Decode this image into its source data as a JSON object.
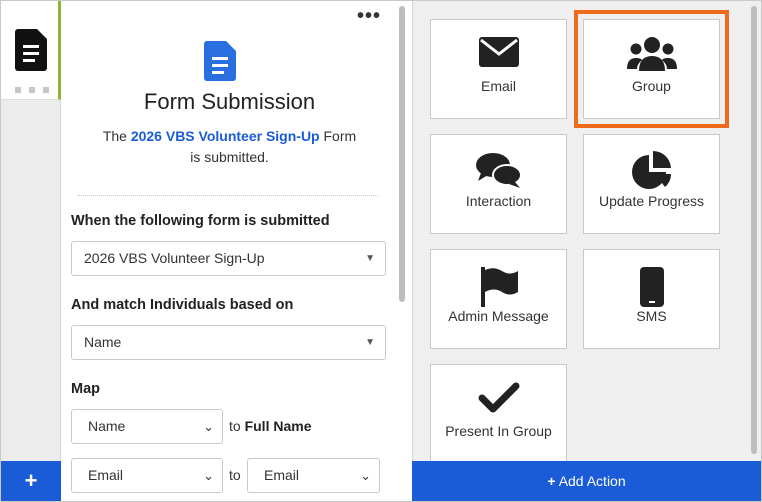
{
  "rail": {
    "add_label": "+"
  },
  "config": {
    "more_label": "•••",
    "title": "Form Submission",
    "subtitle_prefix": "The",
    "subtitle_form": "2026 VBS Volunteer Sign-Up",
    "subtitle_mid": "Form",
    "subtitle_suffix": "is submitted.",
    "form_label": "When the following form is submitted",
    "form_value": "2026 VBS Volunteer Sign-Up",
    "match_label": "And match Individuals based on",
    "match_value": "Name",
    "map_label": "Map",
    "map_rows": [
      {
        "left": "Name",
        "to": "to",
        "right_bold": "Full Name"
      },
      {
        "left": "Email",
        "to": "to",
        "right": "Email"
      }
    ]
  },
  "palette": {
    "tiles": [
      {
        "label": "Email",
        "icon": "envelope-icon"
      },
      {
        "label": "Group",
        "icon": "users-icon",
        "selected": true
      },
      {
        "label": "Interaction",
        "icon": "chat-bubbles-icon"
      },
      {
        "label": "Update Progress",
        "icon": "pie-chart-icon"
      },
      {
        "label": "Admin Message",
        "icon": "flag-icon"
      },
      {
        "label": "SMS",
        "icon": "mobile-phone-icon"
      },
      {
        "label": "Present In Group",
        "icon": "checkmark-icon"
      }
    ],
    "add_action_label": "Add Action",
    "add_action_icon": "+"
  },
  "colors": {
    "accent_blue": "#1a5cd8",
    "selection_orange": "#f06a1c",
    "rail_green": "#8ab832"
  }
}
